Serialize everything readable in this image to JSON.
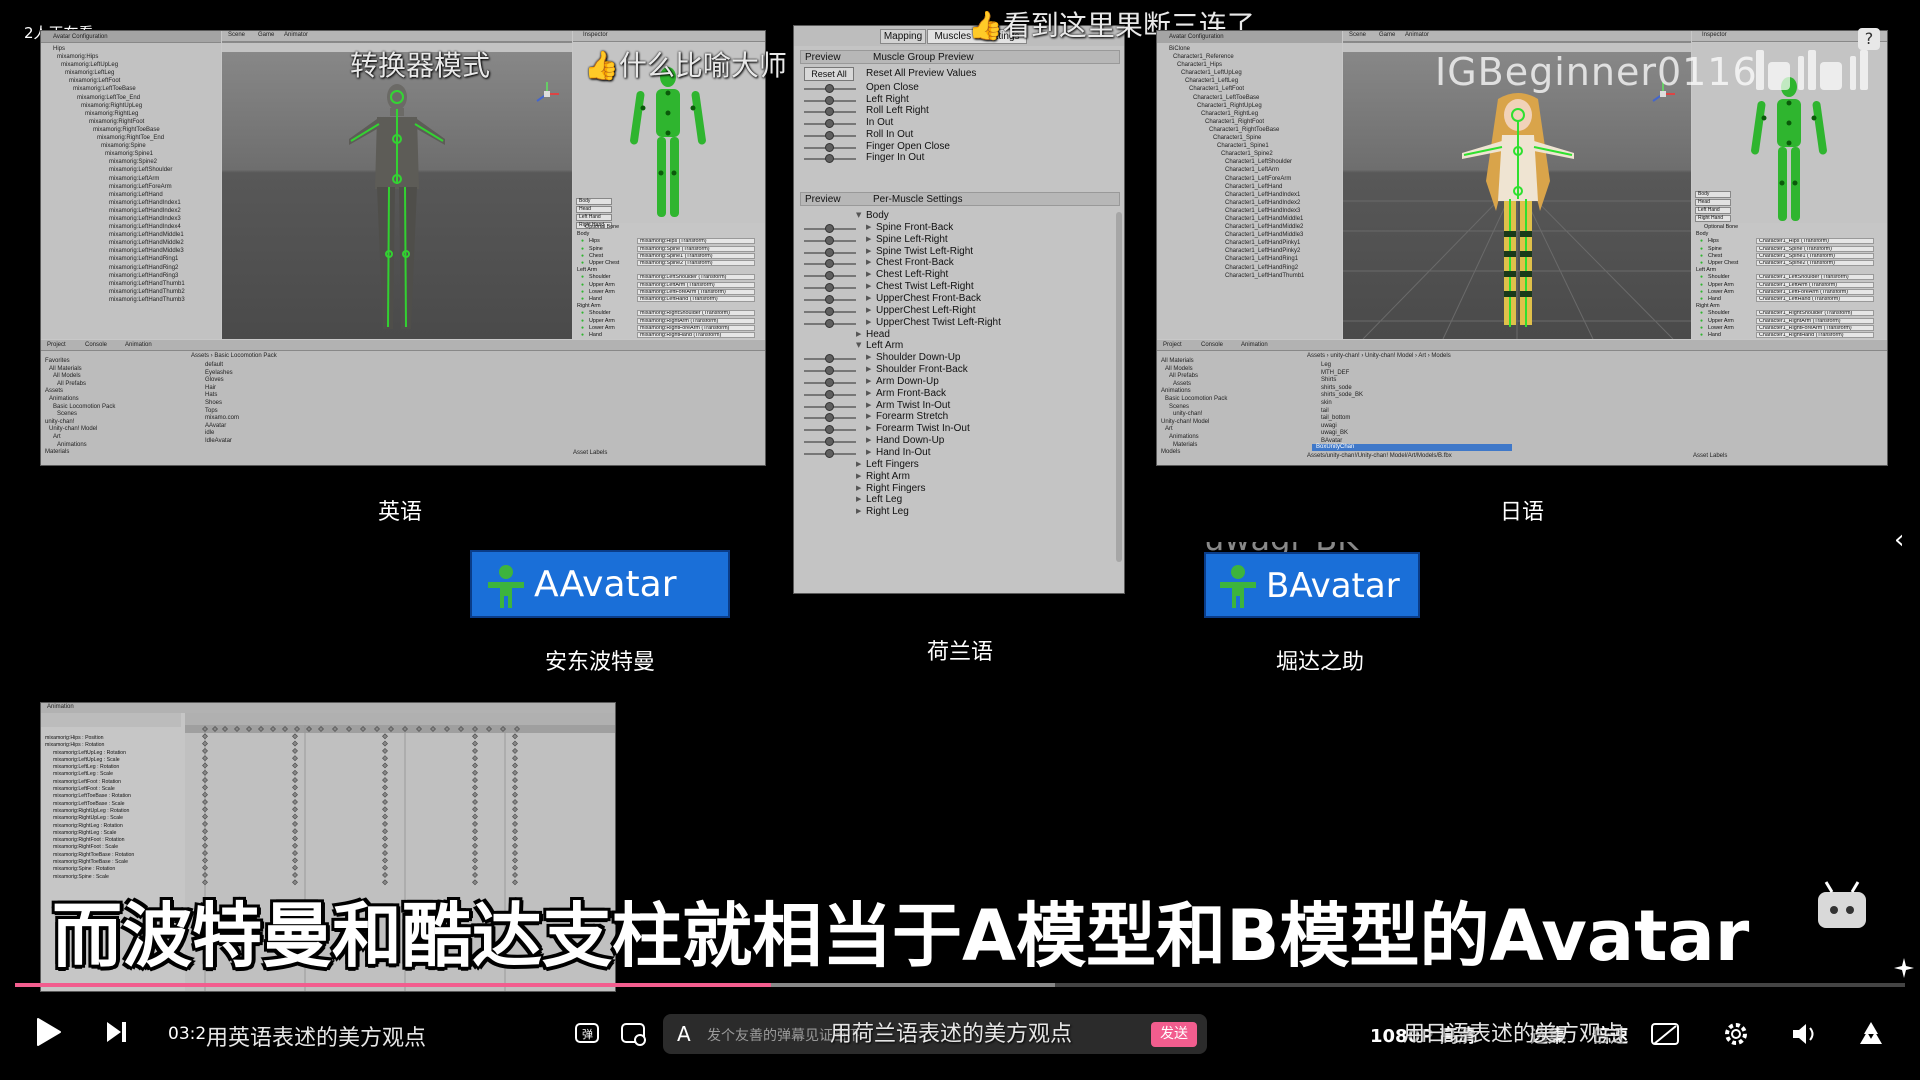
{
  "overlay": {
    "viewers": "2人正在看",
    "danmaku_top_1": "看到这里果断三连了",
    "danmaku_top_2": "转换器模式",
    "danmaku_top_3": "什么比喻大师",
    "uploader_watermark": "IGBeginner0116",
    "subtitle": "而波特曼和酷达支柱就相当于A模型和B模型的Avatar"
  },
  "panels": {
    "left": {
      "caption": "英语",
      "tree_header": "Avatar Configuration",
      "tree_items": [
        "Hips",
        "mixamorig:Hips",
        "mixamorig:LeftUpLeg",
        "mixamorig:LeftLeg",
        "mixamorig:LeftFoot",
        "mixamorig:LeftToeBase",
        "mixamorig:LeftToe_End",
        "mixamorig:RightUpLeg",
        "mixamorig:RightLeg",
        "mixamorig:RightFoot",
        "mixamorig:RightToeBase",
        "mixamorig:RightToe_End",
        "mixamorig:Spine",
        "mixamorig:Spine1",
        "mixamorig:Spine2",
        "mixamorig:LeftShoulder",
        "mixamorig:LeftArm",
        "mixamorig:LeftForeArm",
        "mixamorig:LeftHand",
        "mixamorig:LeftHandIndex1",
        "mixamorig:LeftHandIndex2",
        "mixamorig:LeftHandIndex3",
        "mixamorig:LeftHandIndex4",
        "mixamorig:LeftHandMiddle1",
        "mixamorig:LeftHandMiddle2",
        "mixamorig:LeftHandMiddle3",
        "mixamorig:LeftHandRing1",
        "mixamorig:LeftHandRing2",
        "mixamorig:LeftHandRing3",
        "mixamorig:LeftHandThumb1",
        "mixamorig:LeftHandThumb2",
        "mixamorig:LeftHandThumb3"
      ],
      "scene_tabs": [
        "Scene",
        "Game",
        "Animator"
      ],
      "inspector_tab": "Inspector",
      "insp_buttons": [
        "Body",
        "Head",
        "Left Hand",
        "Right Hand"
      ],
      "optional_bone": "Optional Bone",
      "insp_groups": [
        {
          "name": "Body",
          "rows": [
            [
              "Hips",
              "mixamorig:Hips (Transform)"
            ],
            [
              "Spine",
              "mixamorig:Spine (Transform)"
            ],
            [
              "Chest",
              "mixamorig:Spine1 (Transform)"
            ],
            [
              "Upper Chest",
              "mixamorig:Spine2 (Transform)"
            ]
          ]
        },
        {
          "name": "Left Arm",
          "rows": [
            [
              "Shoulder",
              "mixamorig:LeftShoulder (Transform)"
            ],
            [
              "Upper Arm",
              "mixamorig:LeftArm (Transform)"
            ],
            [
              "Lower Arm",
              "mixamorig:LeftForeArm (Transform)"
            ],
            [
              "Hand",
              "mixamorig:LeftHand (Transform)"
            ]
          ]
        },
        {
          "name": "Right Arm",
          "rows": [
            [
              "Shoulder",
              "mixamorig:RightShoulder (Transform)"
            ],
            [
              "Upper Arm",
              "mixamorig:RightArm (Transform)"
            ],
            [
              "Lower Arm",
              "mixamorig:RightForeArm (Transform)"
            ],
            [
              "Hand",
              "mixamorig:RightHand (Transform)"
            ]
          ]
        },
        {
          "name": "Left Leg",
          "rows": [
            [
              "Upper Leg",
              "mixamorig:LeftUpLeg (Transform)"
            ],
            [
              "Lower Leg",
              "mixamorig:LeftLeg (Transform)"
            ]
          ]
        }
      ],
      "asset_labels": "Asset Labels",
      "proj_tabs": [
        "Project",
        "Console",
        "Animation"
      ],
      "proj_left": [
        "Favorites",
        "All Materials",
        "All Models",
        "All Prefabs",
        "Assets",
        "Animations",
        "Basic Locomotion Pack",
        "Scenes",
        "unity-chan!",
        "Unity-chan! Model",
        "Art",
        "Animations",
        "Materials"
      ],
      "proj_path": "Assets › Basic Locomotion Pack",
      "proj_right": [
        "default",
        "Eyelashes",
        "Gloves",
        "Hair",
        "Hats",
        "Shoes",
        "Tops",
        "mixamo.com",
        "AAvatar",
        "idle",
        "IdleAvatar"
      ]
    },
    "right": {
      "caption": "日语",
      "tree_header": "Avatar Configuration",
      "tree_items": [
        "BiClone",
        "Character1_Reference",
        "Character1_Hips",
        "Character1_LeftUpLeg",
        "Character1_LeftLeg",
        "Character1_LeftFoot",
        "Character1_LeftToeBase",
        "Character1_RightUpLeg",
        "Character1_RightLeg",
        "Character1_RightFoot",
        "Character1_RightToeBase",
        "Character1_Spine",
        "Character1_Spine1",
        "Character1_Spine2",
        "Character1_LeftShoulder",
        "Character1_LeftArm",
        "Character1_LeftForeArm",
        "Character1_LeftHand",
        "Character1_LeftHandIndex1",
        "Character1_LeftHandIndex2",
        "Character1_LeftHandIndex3",
        "Character1_LeftHandMiddle1",
        "Character1_LeftHandMiddle2",
        "Character1_LeftHandMiddle3",
        "Character1_LeftHandPinky1",
        "Character1_LeftHandPinky2",
        "Character1_LeftHandRing1",
        "Character1_LeftHandRing2",
        "Character1_LeftHandThumb1"
      ],
      "scene_tabs": [
        "Scene",
        "Game",
        "Animator"
      ],
      "inspector_tab": "Inspector",
      "insp_buttons": [
        "Body",
        "Head",
        "Left Hand",
        "Right Hand"
      ],
      "optional_bone": "Optional Bone",
      "insp_groups": [
        {
          "name": "Body",
          "rows": [
            [
              "Hips",
              "Character1_Hips (Transform)"
            ],
            [
              "Spine",
              "Character1_Spine (Transform)"
            ],
            [
              "Chest",
              "Character1_Spine1 (Transform)"
            ],
            [
              "Upper Chest",
              "Character1_Spine2 (Transform)"
            ]
          ]
        },
        {
          "name": "Left Arm",
          "rows": [
            [
              "Shoulder",
              "Character1_LeftShoulder (Transform)"
            ],
            [
              "Upper Arm",
              "Character1_LeftArm (Transform)"
            ],
            [
              "Lower Arm",
              "Character1_LeftForeArm (Transform)"
            ],
            [
              "Hand",
              "Character1_LeftHand (Transform)"
            ]
          ]
        },
        {
          "name": "Right Arm",
          "rows": [
            [
              "Shoulder",
              "Character1_RightShoulder (Transform)"
            ],
            [
              "Upper Arm",
              "Character1_RightArm (Transform)"
            ],
            [
              "Lower Arm",
              "Character1_RightForeArm (Transform)"
            ],
            [
              "Hand",
              "Character1_RightHand (Transform)"
            ]
          ]
        },
        {
          "name": "Left Leg",
          "rows": [
            [
              "Upper Leg",
              "Character1_LeftUpLeg (Transform)"
            ],
            [
              "Lower Leg",
              "Character1_LeftLeg (Transform)"
            ]
          ]
        }
      ],
      "asset_labels": "Asset Labels",
      "proj_tabs": [
        "Project",
        "Console",
        "Animation"
      ],
      "proj_left": [
        "All Materials",
        "All Models",
        "All Prefabs",
        "Assets",
        "Animations",
        "Basic Locomotion Pack",
        "Scenes",
        "unity-chan!",
        "Unity-chan! Model",
        "Art",
        "Animations",
        "Materials",
        "Models"
      ],
      "proj_path": "Assets › unity-chan! › Unity-chan! Model › Art › Models",
      "proj_right": [
        "Leg",
        "MTH_DEF",
        "Shirts",
        "shirts_sode",
        "shirts_sode_BK",
        "skin",
        "tail",
        "tail_bottom",
        "uwagi",
        "uwagi_BK",
        "BAvatar"
      ],
      "proj_footer": "Assets/unity-chan!/Unity-chan! Model/Art/Models/B.fbx",
      "proj_selected": "BoxUnityChan"
    },
    "middle": {
      "caption": "荷兰语",
      "tabs": [
        "Mapping",
        "Muscles & Settings"
      ],
      "preview_label": "Preview",
      "group_header": "Muscle Group Preview",
      "reset_button": "Reset All",
      "reset_label": "Reset All Preview Values",
      "group_rows": [
        "Open Close",
        "Left Right",
        "Roll Left Right",
        "In Out",
        "Roll In Out",
        "Finger Open Close",
        "Finger In Out"
      ],
      "per_header": "Per-Muscle Settings",
      "per_rows": [
        {
          "label": "Body",
          "kind": "open"
        },
        {
          "label": "Spine Front-Back",
          "kind": "child"
        },
        {
          "label": "Spine Left-Right",
          "kind": "child"
        },
        {
          "label": "Spine Twist Left-Right",
          "kind": "child"
        },
        {
          "label": "Chest Front-Back",
          "kind": "child"
        },
        {
          "label": "Chest Left-Right",
          "kind": "child"
        },
        {
          "label": "Chest Twist Left-Right",
          "kind": "child"
        },
        {
          "label": "UpperChest Front-Back",
          "kind": "child"
        },
        {
          "label": "UpperChest Left-Right",
          "kind": "child"
        },
        {
          "label": "UpperChest Twist Left-Right",
          "kind": "child"
        },
        {
          "label": "Head",
          "kind": "closed"
        },
        {
          "label": "Left Arm",
          "kind": "open"
        },
        {
          "label": "Shoulder Down-Up",
          "kind": "child"
        },
        {
          "label": "Shoulder Front-Back",
          "kind": "child"
        },
        {
          "label": "Arm Down-Up",
          "kind": "child"
        },
        {
          "label": "Arm Front-Back",
          "kind": "child"
        },
        {
          "label": "Arm Twist In-Out",
          "kind": "child"
        },
        {
          "label": "Forearm Stretch",
          "kind": "child"
        },
        {
          "label": "Forearm Twist In-Out",
          "kind": "child"
        },
        {
          "label": "Hand Down-Up",
          "kind": "child"
        },
        {
          "label": "Hand In-Out",
          "kind": "child"
        },
        {
          "label": "Left Fingers",
          "kind": "closed"
        },
        {
          "label": "Right Arm",
          "kind": "closed"
        },
        {
          "label": "Right Fingers",
          "kind": "closed"
        },
        {
          "label": "Left Leg",
          "kind": "closed"
        },
        {
          "label": "Right Leg",
          "kind": "closed"
        }
      ]
    },
    "badge_a": {
      "text": "AAvatar",
      "caption": "安东波特曼"
    },
    "badge_b": {
      "text": "BAvatar",
      "above": "uwagi_BK",
      "caption": "堀达之助"
    },
    "anim": {
      "tab": "Animation",
      "props": [
        "mixamorig:Hips : Position",
        "mixamorig:Hips : Rotation",
        "mixamorig:LeftUpLeg : Rotation",
        "mixamorig:LeftUpLeg : Scale",
        "mixamorig:LeftLeg : Rotation",
        "mixamorig:LeftLeg : Scale",
        "mixamorig:LeftFoot : Rotation",
        "mixamorig:LeftFoot : Scale",
        "mixamorig:LeftToeBase : Rotation",
        "mixamorig:LeftToeBase : Scale",
        "mixamorig:RightUpLeg : Rotation",
        "mixamorig:RightUpLeg : Scale",
        "mixamorig:RightLeg : Rotation",
        "mixamorig:RightLeg : Scale",
        "mixamorig:RightFoot : Rotation",
        "mixamorig:RightFoot : Scale",
        "mixamorig:RightToeBase : Rotation",
        "mixamorig:RightToeBase : Scale",
        "mixamorig:Spine : Rotation",
        "mixamorig:Spine : Scale"
      ]
    }
  },
  "player": {
    "time": "03:2",
    "danmaku_bottom_1": "用英语表述的美方观点",
    "danmaku_bottom_2": "用荷兰语表述的美方观点",
    "danmaku_bottom_3": "用日语表述的美方观点",
    "danmaku_placeholder": "发个友善的弹幕见证当下",
    "send_label": "发送",
    "quality": "1080P 高清",
    "select_label": "选集",
    "speed_label": "倍速",
    "progress_played": 0.4,
    "progress_buffered": 0.55,
    "accent_color": "#f25d8e",
    "send_color": "#f25d8e",
    "icons": [
      "play-icon",
      "next-icon",
      "danmaku-toggle-icon",
      "danmaku-settings-icon",
      "settings-icon",
      "volume-icon",
      "fullscreen-icon"
    ]
  }
}
